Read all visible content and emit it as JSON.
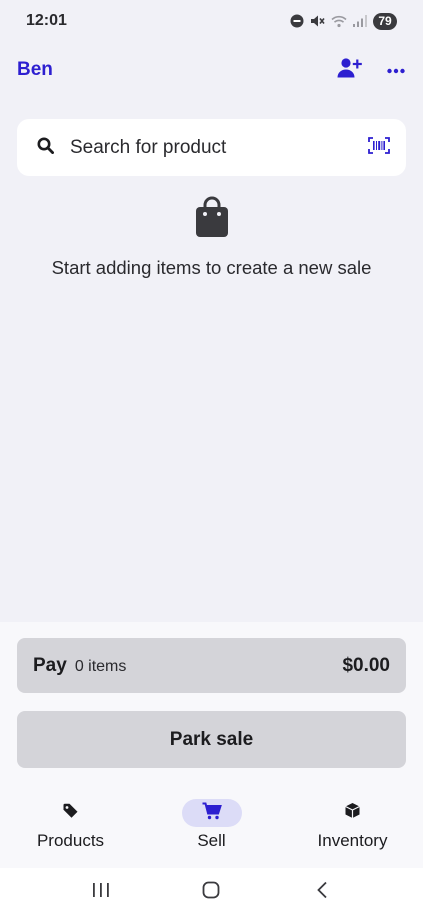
{
  "status_bar": {
    "time": "12:01",
    "battery": "79",
    "icons": [
      "do-not-disturb-icon",
      "mute-icon",
      "wifi-icon",
      "signal-icon"
    ]
  },
  "header": {
    "user_name": "Ben",
    "actions": [
      "add-user-icon",
      "more-icon"
    ]
  },
  "search": {
    "placeholder": "Search for product",
    "value": "",
    "icons": [
      "search-icon",
      "barcode-scanner-icon"
    ]
  },
  "empty_state": {
    "icon": "shopping-bag-icon",
    "text": "Start adding items to create a new sale"
  },
  "checkout": {
    "pay_label": "Pay",
    "item_count": "0 items",
    "total": "$0.00",
    "park_label": "Park sale"
  },
  "tabs": [
    {
      "label": "Products",
      "icon": "tag-icon",
      "active": false
    },
    {
      "label": "Sell",
      "icon": "cart-icon",
      "active": true
    },
    {
      "label": "Inventory",
      "icon": "box-icon",
      "active": false
    }
  ],
  "nav_bar": {
    "buttons": [
      "recent-apps-icon",
      "home-icon",
      "back-icon"
    ]
  },
  "colors": {
    "accent": "#2d1fd0",
    "background": "#f1f1f7",
    "button_gray": "#d4d4d9",
    "tab_active_bg": "#dcdcf7"
  }
}
